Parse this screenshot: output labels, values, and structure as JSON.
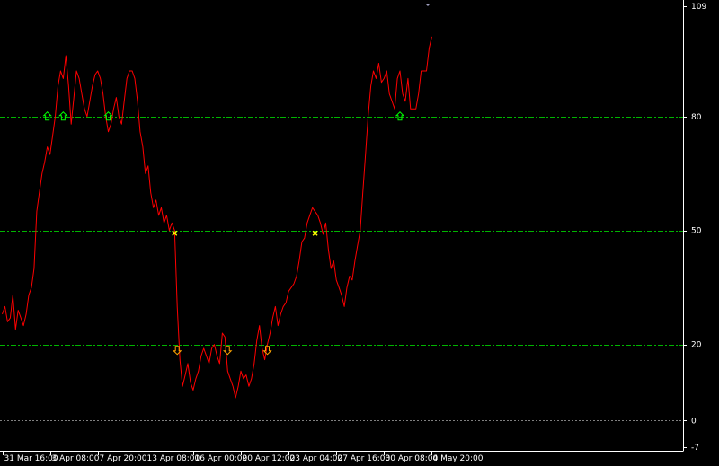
{
  "colors": {
    "background": "#000000",
    "frame": "#ffffff",
    "level_line": "#00b400",
    "zero_line": "#808080",
    "series": "#ff0000",
    "buy_arrow": "#00ff00",
    "sell_arrow": "#ffa500",
    "cross": "#ffff00"
  },
  "chart_data": {
    "type": "line",
    "title": "",
    "xlabel": "",
    "ylabel": "",
    "ylim": [
      -7,
      109
    ],
    "grid": false,
    "y_ticks": [
      109,
      80,
      50,
      20,
      0,
      -7
    ],
    "levels": [
      80,
      50,
      20
    ],
    "zero_level": 0,
    "x_ticks": [
      {
        "index": 0,
        "label": "31 Mar 16:00"
      },
      {
        "index": 18,
        "label": "3 Apr 08:00"
      },
      {
        "index": 36,
        "label": "7 Apr 20:00"
      },
      {
        "index": 54,
        "label": "13 Apr 08:00"
      },
      {
        "index": 72,
        "label": "16 Apr 00:00"
      },
      {
        "index": 90,
        "label": "20 Apr 12:00"
      },
      {
        "index": 108,
        "label": "23 Apr 04:00"
      },
      {
        "index": 126,
        "label": "27 Apr 16:00"
      },
      {
        "index": 144,
        "label": "30 Apr 08:00"
      },
      {
        "index": 162,
        "label": "4 May 20:00"
      }
    ],
    "series": [
      {
        "values": [
          28,
          30,
          26,
          27,
          33,
          24,
          29,
          27,
          25,
          28,
          33,
          35,
          40,
          55,
          60,
          65,
          68,
          72,
          70,
          75,
          80,
          88,
          92,
          90,
          96,
          88,
          78,
          85,
          92,
          90,
          86,
          82,
          80,
          84,
          88,
          91,
          92,
          90,
          86,
          80,
          76,
          78,
          82,
          85,
          80,
          78,
          84,
          90,
          92,
          92,
          90,
          84,
          76,
          72,
          65,
          67,
          60,
          56,
          58,
          54,
          56,
          52,
          54,
          50,
          52,
          50,
          30,
          16,
          9,
          12,
          15,
          10,
          8,
          11,
          13,
          17,
          19,
          17,
          15,
          19,
          20,
          17,
          15,
          23,
          22,
          13,
          11,
          9,
          6,
          9,
          13,
          11,
          12,
          9,
          11,
          15,
          21,
          25,
          19,
          16,
          20,
          23,
          27,
          30,
          25,
          28,
          30,
          31,
          34,
          35,
          36,
          38,
          42,
          47,
          48,
          52,
          54,
          56,
          55,
          54,
          52,
          49,
          52,
          45,
          40,
          42,
          37,
          35,
          33,
          30,
          35,
          38,
          37,
          42,
          46,
          50,
          60,
          70,
          80,
          88,
          92,
          90,
          94,
          89,
          90,
          92,
          86,
          84,
          82,
          90,
          92,
          86,
          84,
          90,
          82,
          82,
          82,
          86,
          92,
          92,
          92,
          98,
          101
        ]
      }
    ],
    "markers": [
      {
        "type": "up-arrow",
        "index": 17,
        "value": 80
      },
      {
        "type": "up-arrow",
        "index": 23,
        "value": 80
      },
      {
        "type": "up-arrow",
        "index": 40,
        "value": 80
      },
      {
        "type": "cross",
        "index": 65,
        "value": 50
      },
      {
        "type": "down-arrow",
        "index": 66,
        "value": 20
      },
      {
        "type": "down-arrow",
        "index": 85,
        "value": 20
      },
      {
        "type": "down-arrow",
        "index": 100,
        "value": 20
      },
      {
        "type": "cross",
        "index": 118,
        "value": 50
      },
      {
        "type": "up-arrow",
        "index": 150,
        "value": 80
      }
    ]
  }
}
